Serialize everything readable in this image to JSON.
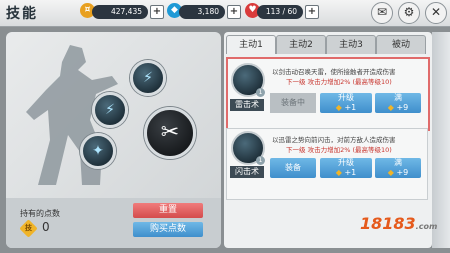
{
  "header": {
    "title": "技能",
    "gold": "427,435",
    "gems": "3,180",
    "stamina": "113 / 60",
    "gold_icon": "gold-coin",
    "gem_icon": "diamond",
    "stamina_icon": "heart"
  },
  "tabs": [
    {
      "label": "主动1",
      "active": true
    },
    {
      "label": "主动2",
      "active": false
    },
    {
      "label": "主动3",
      "active": false
    },
    {
      "label": "被动",
      "active": false
    }
  ],
  "points": {
    "label": "持有的点数",
    "icon_text": "技",
    "value": "0",
    "reset_label": "重置",
    "buy_label": "购买点数"
  },
  "skills": [
    {
      "name": "雷击术",
      "level_badge": "1",
      "desc": "以剑击动召唤天雷，使所接触者开造成伤害",
      "next": "下一级 攻击力增加2%",
      "next_req": "(最高等级10)",
      "equip_label": "装备中",
      "upgrade_label": "升级",
      "upgrade_cost": "+1",
      "max_label": "满",
      "max_cost": "+9"
    },
    {
      "name": "闪击术",
      "level_badge": "1",
      "desc": "以迅雷之势向前闪击，对前方敌人造成伤害",
      "next": "下一级 攻击力增加2%",
      "next_req": "(最高等级10)",
      "equip_label": "装备",
      "upgrade_label": "升级",
      "upgrade_cost": "+1",
      "max_label": "满",
      "max_cost": "+9"
    }
  ],
  "watermark": {
    "brand": "18183",
    "sub": ".com"
  }
}
